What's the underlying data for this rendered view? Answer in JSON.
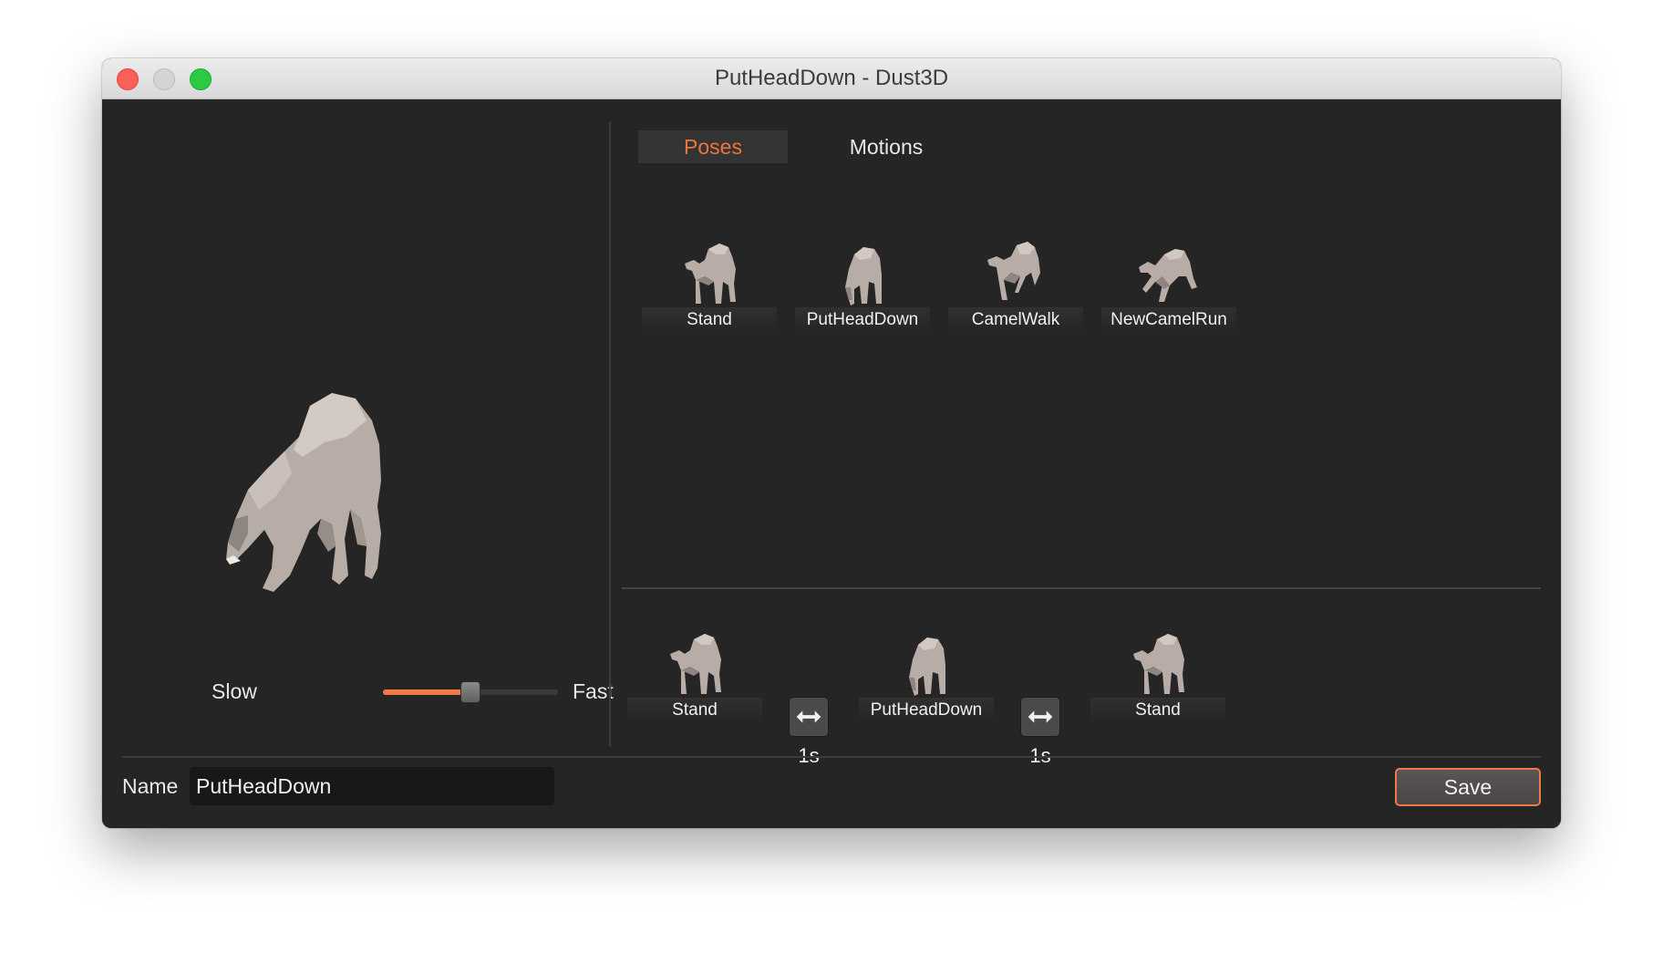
{
  "window": {
    "title": "PutHeadDown - Dust3D"
  },
  "preview": {
    "slider": {
      "min_label": "Slow",
      "max_label": "Fast",
      "value": 0.5
    }
  },
  "tabs": [
    {
      "label": "Poses",
      "active": true
    },
    {
      "label": "Motions",
      "active": false
    }
  ],
  "poses": [
    {
      "label": "Stand",
      "pose": "stand"
    },
    {
      "label": "PutHeadDown",
      "pose": "headdown"
    },
    {
      "label": "CamelWalk",
      "pose": "walk"
    },
    {
      "label": "NewCamelRun",
      "pose": "run"
    }
  ],
  "timeline": {
    "clips": [
      {
        "label": "Stand",
        "pose": "stand"
      },
      {
        "label": "PutHeadDown",
        "pose": "headdown"
      },
      {
        "label": "Stand",
        "pose": "stand"
      }
    ],
    "interpolations": [
      {
        "duration": "1s",
        "icon": "double-arrow-icon"
      },
      {
        "duration": "1s",
        "icon": "double-arrow-icon"
      }
    ]
  },
  "footer": {
    "name_label": "Name",
    "name_value": "PutHeadDown",
    "save_label": "Save"
  },
  "colors": {
    "accent": "#f0723d",
    "background": "#252525",
    "model": "#b8aca6"
  }
}
